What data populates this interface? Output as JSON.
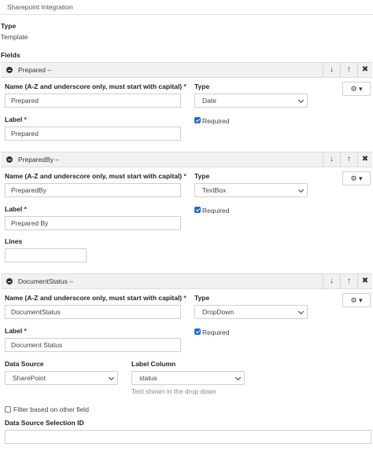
{
  "top_tab": {
    "label": "Sharepoint Integration"
  },
  "type_section": {
    "heading": "Type",
    "value": "Template"
  },
  "fields_heading": "Fields",
  "header_icons": {
    "down": "↓",
    "up": "↑",
    "remove": "✖",
    "gear": "⚙ ▾"
  },
  "fields": [
    {
      "title": "Prepared –",
      "name_label": "Name (A-Z and underscore only, must start with capital)",
      "name_value": "Prepared",
      "type_label": "Type",
      "type_value": "Date",
      "label_label": "Label",
      "label_value": "Prepared",
      "required_label": "Required",
      "required": true
    },
    {
      "title": "PreparedBy –",
      "name_label": "Name (A-Z and underscore only, must start with capital)",
      "name_value": "PreparedBy",
      "type_label": "Type",
      "type_value": "TextBox",
      "label_label": "Label",
      "label_value": "Prepared By",
      "required_label": "Required",
      "required": true,
      "lines_label": "Lines",
      "lines_value": ""
    },
    {
      "title": "DocumentStatus –",
      "name_label": "Name (A-Z and underscore only, must start with capital)",
      "name_value": "DocumentStatus",
      "type_label": "Type",
      "type_value": "DropDown",
      "label_label": "Label",
      "label_value": "Document Status",
      "required_label": "Required",
      "required": true,
      "data_source_label": "Data Source",
      "data_source_value": "SharePoint",
      "label_column_label": "Label Column",
      "label_column_value": "status",
      "label_column_hint": "Text shown in the drop down",
      "filter_label": "Filter based on other field",
      "filter_checked": false,
      "ds_selection_label": "Data Source Selection ID",
      "ds_selection_value": ""
    }
  ],
  "required_marker": "*"
}
